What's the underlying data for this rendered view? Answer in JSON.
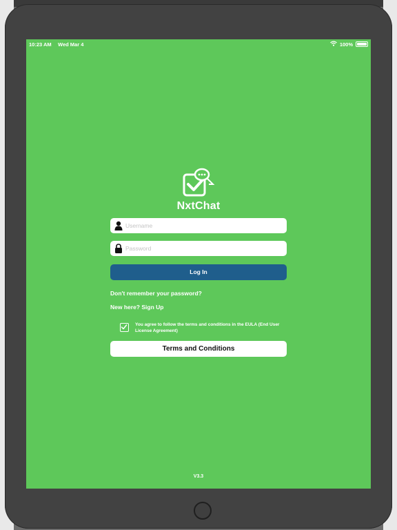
{
  "status_bar": {
    "time": "10:23 AM",
    "date": "Wed Mar 4",
    "battery": "100%"
  },
  "app": {
    "title": "NxtChat",
    "version": "V3.3",
    "accent": "#5ec85a",
    "login_color": "#1f5e8c"
  },
  "login_form": {
    "username_placeholder": "Username",
    "password_placeholder": "Password",
    "login_label": "Log In",
    "forgot_label": "Don't remember your password?",
    "signup_label": "New here? Sign Up"
  },
  "eula": {
    "checked": true,
    "text": "You agree to follow the terms and conditions in the EULA (End User License Agreement)",
    "terms_button": "Terms and Conditions"
  },
  "icons": {
    "logo": "chat-checkbox-logo-icon",
    "user": "user-icon",
    "lock": "lock-icon",
    "wifi": "wifi-icon",
    "battery": "battery-icon",
    "check": "check-icon"
  }
}
